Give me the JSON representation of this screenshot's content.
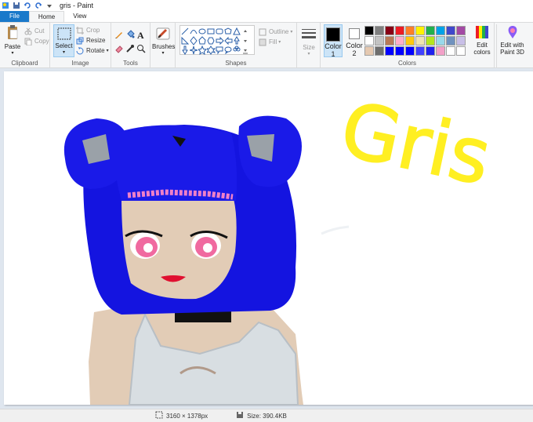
{
  "window": {
    "title": "gris - Paint"
  },
  "tabs": {
    "file": "File",
    "home": "Home",
    "view": "View"
  },
  "clipboard": {
    "paste": "Paste",
    "cut": "Cut",
    "copy": "Copy",
    "label": "Clipboard"
  },
  "image": {
    "select": "Select",
    "crop": "Crop",
    "resize": "Resize",
    "rotate": "Rotate",
    "label": "Image"
  },
  "tools": {
    "label": "Tools"
  },
  "brushes": {
    "label": "Brushes"
  },
  "shapes": {
    "outline": "Outline",
    "fill": "Fill",
    "label": "Shapes"
  },
  "size": {
    "label": "Size"
  },
  "colors": {
    "color1": "Color",
    "color1_num": "1",
    "color2": "Color",
    "color2_num": "2",
    "edit_colors_1": "Edit",
    "edit_colors_2": "colors",
    "paint3d_1": "Edit with",
    "paint3d_2": "Paint 3D",
    "label": "Colors",
    "color1_value": "#000000",
    "color2_value": "#ffffff",
    "palette": [
      "#000000",
      "#7f7f7f",
      "#880015",
      "#ed1c24",
      "#ff7f27",
      "#fff200",
      "#22b14c",
      "#00a2e8",
      "#3f48cc",
      "#a349a4",
      "#ffffff",
      "#c3c3c3",
      "#b97a57",
      "#ffaec9",
      "#ffc90e",
      "#efe4b0",
      "#b5e61d",
      "#99d9ea",
      "#7092be",
      "#c8bfe7",
      "#e5c9b1",
      "#6e6e6e",
      "#0000ff",
      "#0000ff",
      "#0000ff",
      "#4040ff",
      "#2020ee",
      "#f2a0c8",
      "#ffffff",
      "#ffffff"
    ]
  },
  "canvas": {
    "text": "Gris"
  },
  "status": {
    "dimensions": "3160 × 1378px",
    "size": "Size: 390.4KB"
  }
}
